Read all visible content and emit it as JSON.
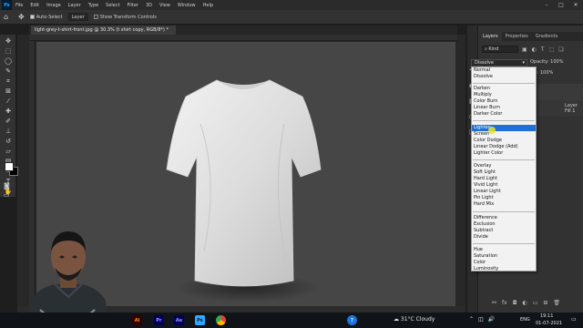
{
  "menubar": {
    "app_logo": "Ps",
    "items": [
      "File",
      "Edit",
      "Image",
      "Layer",
      "Type",
      "Select",
      "Filter",
      "3D",
      "View",
      "Window",
      "Help"
    ]
  },
  "options_bar": {
    "auto_select_label": "Auto-Select",
    "auto_select_target": "Layer",
    "show_transform_label": "Show Transform Controls"
  },
  "document": {
    "tab_title": "light-grey-t-shirt-front.jpg @ 30.3% (t shirt copy, RGB/8*) *"
  },
  "panels": {
    "tabs": [
      "Layers",
      "Properties",
      "Gradients"
    ],
    "kind_filter": "Kind",
    "blend_mode_value": "Dissolve",
    "opacity_label": "Opacity:",
    "opacity_value": "100%",
    "fill_label": "Fill:",
    "fill_value": "100%",
    "layer_name": "Layer Fill 1"
  },
  "blend_menu": {
    "groups": [
      [
        "Normal",
        "Dissolve"
      ],
      [
        "Darken",
        "Multiply",
        "Color Burn",
        "Linear Burn",
        "Darker Color"
      ],
      [
        "Lighten",
        "Screen",
        "Color Dodge",
        "Linear Dodge (Add)",
        "Lighter Color"
      ],
      [
        "Overlay",
        "Soft Light",
        "Hard Light",
        "Vivid Light",
        "Linear Light",
        "Pin Light",
        "Hard Mix"
      ],
      [
        "Difference",
        "Exclusion",
        "Subtract",
        "Divide"
      ],
      [
        "Hue",
        "Saturation",
        "Color",
        "Luminosity"
      ]
    ],
    "highlighted": "Lighten"
  },
  "taskbar": {
    "weather": "31°C  Cloudy",
    "language": "ENG",
    "time": "19:11",
    "date": "01-07-2021",
    "apps": [
      "Ai",
      "Pr",
      "Ae",
      "chrome"
    ]
  },
  "colors": {
    "accent": "#1f6fd6",
    "workspace": "#282828",
    "canvas": "#464646",
    "panel": "#323232"
  }
}
